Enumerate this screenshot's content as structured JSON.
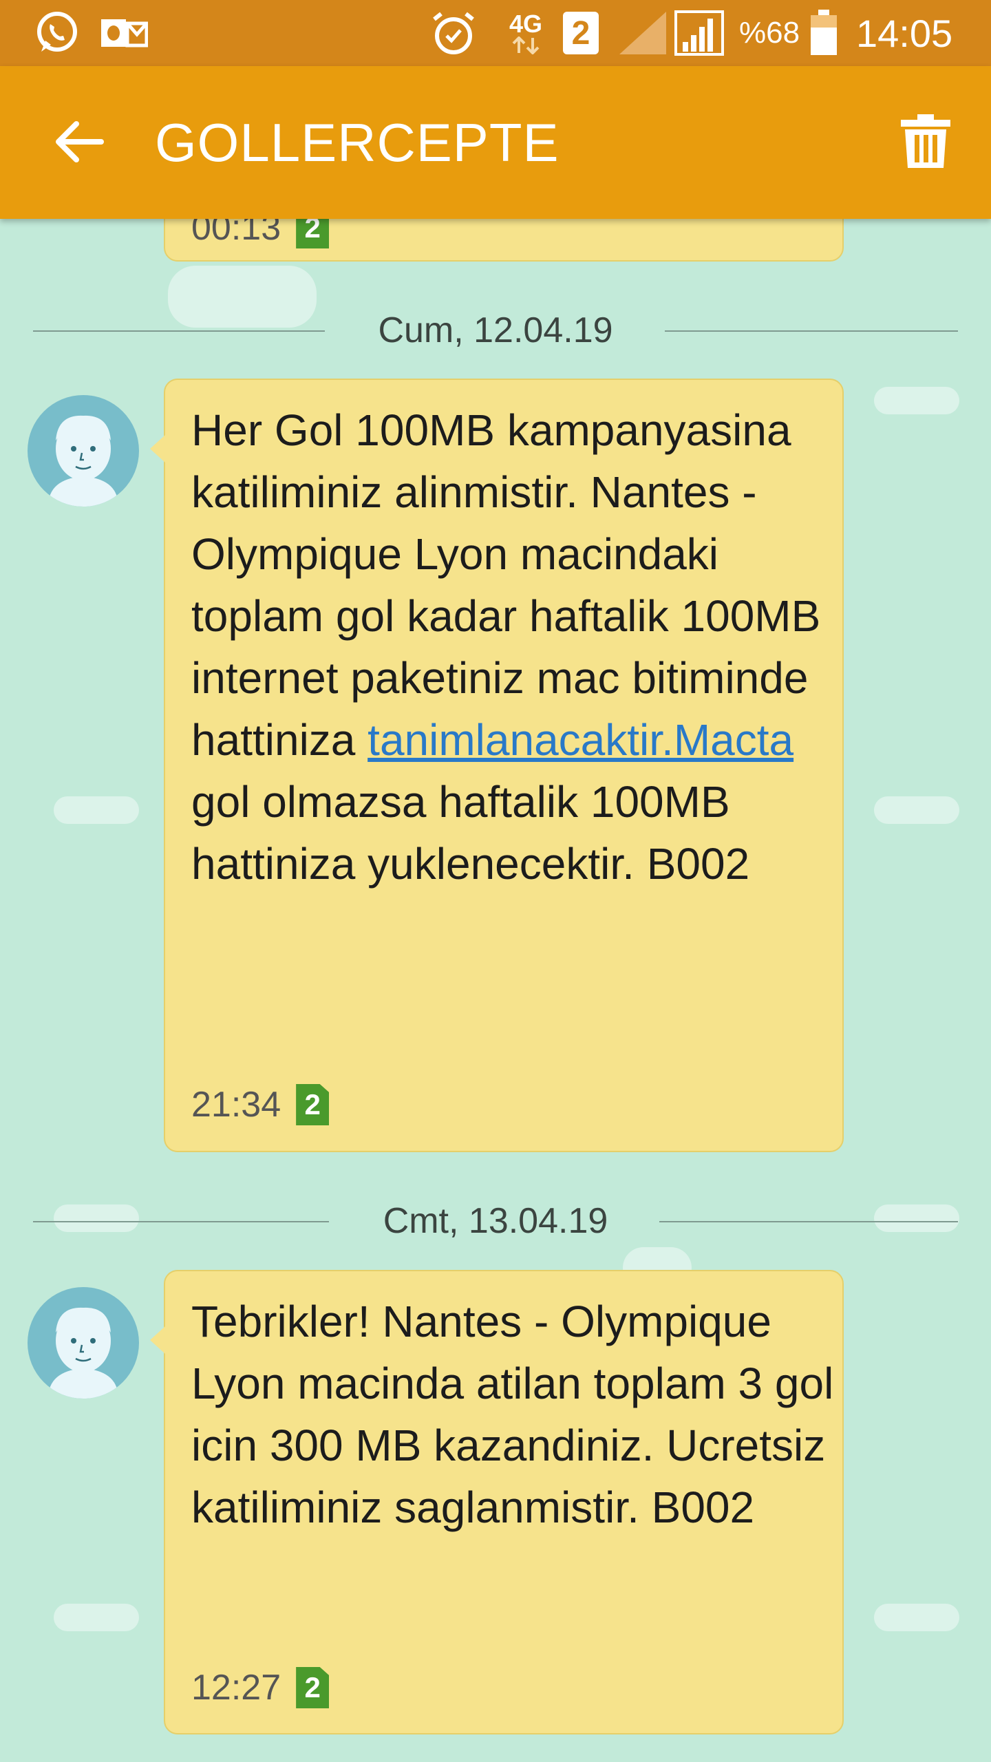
{
  "status_bar": {
    "network": "4G",
    "sim_slot": "2",
    "battery_percent": "%68",
    "battery_level": 0.68,
    "time": "14:05",
    "icons": [
      "whatsapp-icon",
      "outlook-icon",
      "alarm-icon",
      "data-arrows-icon",
      "sim2-icon",
      "signal-sim1-icon",
      "signal-sim2-icon",
      "battery-icon"
    ]
  },
  "app_bar": {
    "title": "GOLLERCEPTE",
    "back_icon": "arrow-back-icon",
    "delete_icon": "trash-icon"
  },
  "prev_message": {
    "time": "00:13",
    "sim": "2"
  },
  "conversation": [
    {
      "date": "Cum, 12.04.19",
      "message": {
        "text_before_link": "Her Gol 100MB kampanyasina katiliminiz alinmistir. Nantes - Olympique Lyon macindaki toplam gol kadar haftalik 100MB internet paketiniz mac bitiminde hattiniza ",
        "link": "tanimlanacaktir.Macta",
        "text_after_link": " gol olmazsa haftalik 100MB hattiniza yuklenecektir. B002",
        "time": "21:34",
        "sim": "2"
      }
    },
    {
      "date": "Cmt, 13.04.19",
      "message": {
        "text": "Tebrikler! Nantes - Olympique Lyon macinda atilan toplam 3 gol icin 300 MB kazandiniz. Ucretsiz katiliminiz saglanmistir. B002",
        "time": "12:27",
        "sim": "2"
      }
    }
  ],
  "colors": {
    "status_bar": "#d4861a",
    "app_bar": "#e89c0d",
    "background": "#c2ead9",
    "bubble": "#f6e38c",
    "link": "#2979c8",
    "sim_badge": "#4a9a2c"
  }
}
